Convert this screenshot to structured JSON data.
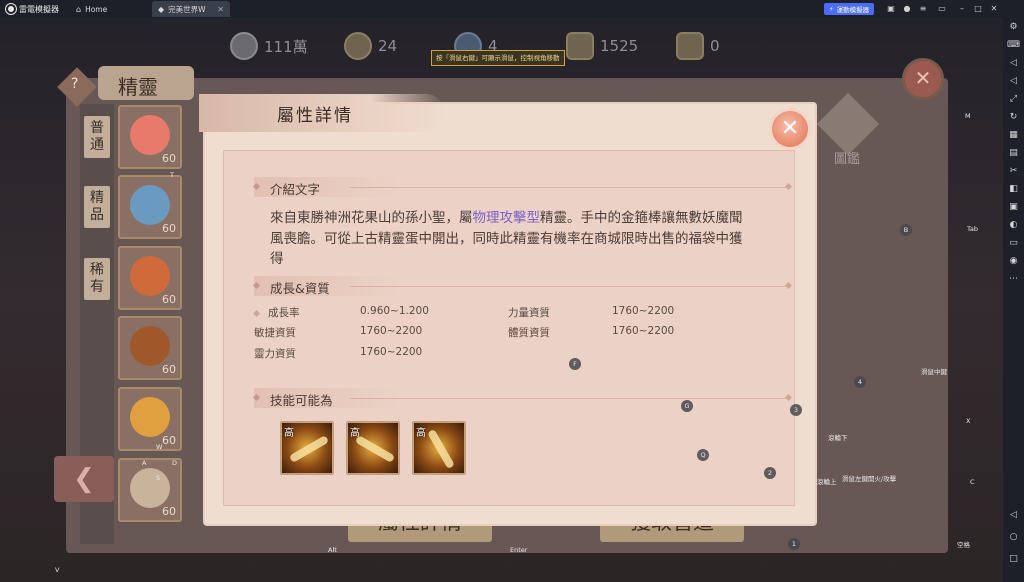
{
  "emulator": {
    "brand": "雷電模擬器",
    "tabs": [
      {
        "label": "Home"
      },
      {
        "label": "完美世界W"
      }
    ],
    "accelerate_label": "運動模擬器"
  },
  "game": {
    "resources": [
      "111萬",
      "24",
      "4",
      "1525",
      "0"
    ],
    "background_title": "精靈",
    "categories": [
      "普通",
      "精品",
      "稀有"
    ],
    "slot_levels": [
      "60",
      "60",
      "60",
      "60",
      "60",
      "60"
    ],
    "right_emblem_label": "圖鑑",
    "bottom_buttons": [
      "屬性詳情",
      "獲取管道"
    ],
    "hint": "按「滑鼠右鍵」可顯示滑鼠，控制視角移動"
  },
  "modal": {
    "title": "屬性詳情",
    "intro": {
      "heading": "介紹文字",
      "text_before": "來自東勝神洲花果山的孫小聖，屬",
      "highlight": "物理攻擊型",
      "text_after": "精靈。手中的金箍棒讓無數妖魔聞風喪膽。可從上古精靈蛋中開出，同時此精靈有機率在商城限時出售的福袋中獲得"
    },
    "growth": {
      "heading": "成長&資質",
      "stats": [
        {
          "label": "成長率",
          "value": "0.960~1.200"
        },
        {
          "label": "力量資質",
          "value": "1760~2200"
        },
        {
          "label": "敏捷資質",
          "value": "1760~2200"
        },
        {
          "label": "體質資質",
          "value": "1760~2200"
        },
        {
          "label": "靈力資質",
          "value": "1760~2200"
        }
      ]
    },
    "skills": {
      "heading": "技能可能為",
      "items": [
        {
          "tag": "高"
        },
        {
          "tag": "高"
        },
        {
          "tag": "高"
        }
      ]
    }
  },
  "keymaps": {
    "m": "M",
    "tab": "Tab",
    "b": "B",
    "t": "T",
    "a": "A",
    "d": "D",
    "s": "S",
    "w": "W",
    "f": "F",
    "four": "4",
    "g": "G",
    "three": "3",
    "q": "Q",
    "two": "2",
    "one": "1",
    "x": "X",
    "c": "C",
    "alt": "Alt",
    "enter": "Enter",
    "v": "V",
    "wheel_middle": "滑鼠中鍵",
    "wheel_down": "滾輪下",
    "wheel_up": "滾輪上",
    "left_click_fire": "滑鼠左鍵開火/攻擊",
    "space": "空格"
  },
  "colors": {
    "accent_blue": "#4a6cf7",
    "highlight_purple": "#7a62c8",
    "modal_bg": "#efddd0",
    "close_button": "#ea8f74"
  }
}
